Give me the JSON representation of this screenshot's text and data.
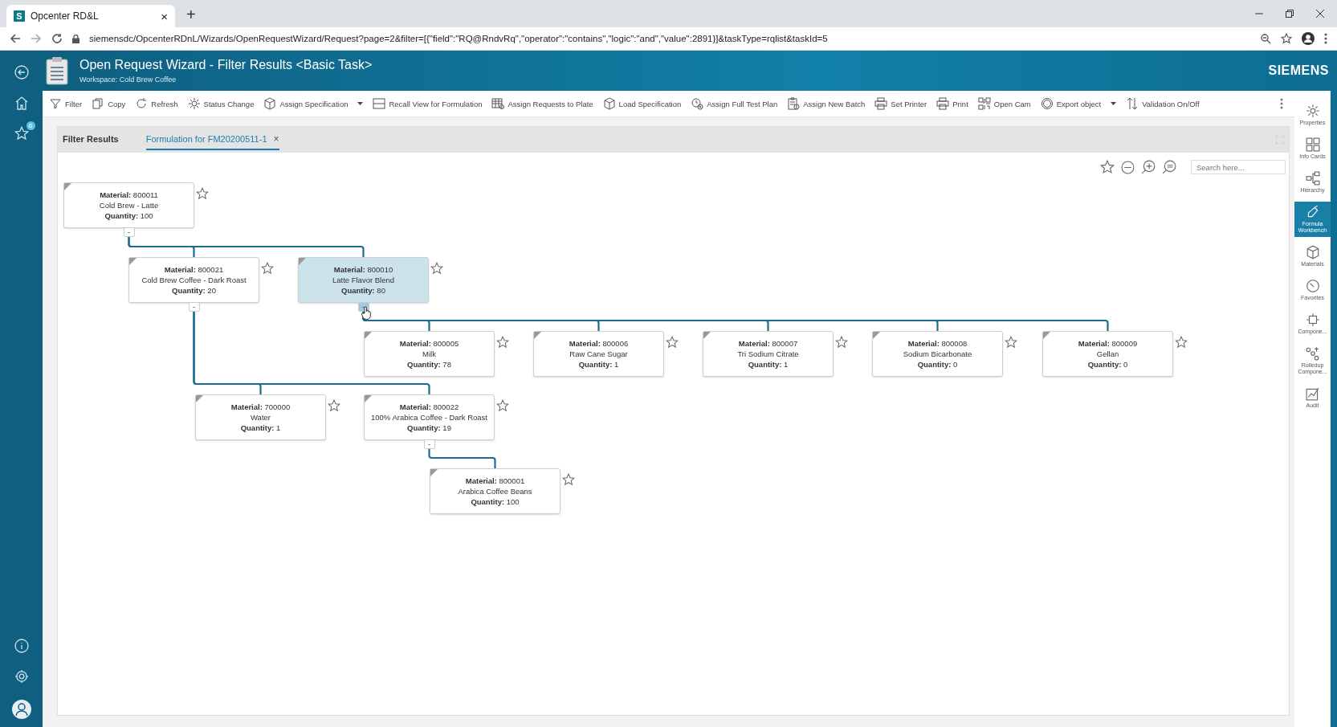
{
  "browser": {
    "tab": {
      "favicon": "S",
      "title": "Opcenter RD&L",
      "close": "×"
    },
    "new_tab": "+",
    "url": "siemensdc/OpcenterRDnL/Wizards/OpenRequestWizard/Request?page=2&filter=[{\"field\":\"RQ@RndvRq\",\"operator\":\"contains\",\"logic\":\"and\",\"value\":2891}]&taskType=rqlist&taskId=5"
  },
  "header": {
    "title": "Open Request Wizard - Filter Results <Basic Task>",
    "workspace": "Workspace: Cold Brew Coffee",
    "logo": "SIEMENS"
  },
  "left_nav": {
    "favorites_badge": "6"
  },
  "toolbar": [
    {
      "label": "Filter",
      "menu": false
    },
    {
      "label": "Copy",
      "menu": false
    },
    {
      "label": "Refresh",
      "menu": false
    },
    {
      "label": "Status Change",
      "menu": false
    },
    {
      "label": "Assign Specification",
      "menu": true
    },
    {
      "label": "Recall View for Formulation",
      "menu": false
    },
    {
      "label": "Assign Requests to Plate",
      "menu": false
    },
    {
      "label": "Load Specification",
      "menu": false
    },
    {
      "label": "Assign Full Test Plan",
      "menu": false
    },
    {
      "label": "Assign New Batch",
      "menu": false
    },
    {
      "label": "Set Printer",
      "menu": false
    },
    {
      "label": "Print",
      "menu": false
    },
    {
      "label": "Open Cam",
      "menu": false
    },
    {
      "label": "Export object",
      "menu": true
    },
    {
      "label": "Validation On/Off",
      "menu": false
    }
  ],
  "tabs": [
    {
      "label": "Filter Results",
      "selected": false
    },
    {
      "label": "Formulation for FM20200511-1",
      "selected": true,
      "close": "×"
    }
  ],
  "canvas": {
    "search": {
      "placeholder": "Search here..."
    },
    "tree": {
      "lines": [
        "**Material:** 800011",
        "Cold Brew - Latte",
        "**Quantity:** 100"
      ],
      "selected": false,
      "toggle": "-",
      "children": [
        {
          "lines": [
            "**Material:** 800021",
            "Cold Brew Coffee - Dark Roast",
            "**Quantity:** 20"
          ],
          "selected": false,
          "toggle": "-",
          "children": [
            {
              "lines": [
                "**Material:** 700000",
                "Water",
                "**Quantity:** 1"
              ],
              "selected": false
            },
            {
              "lines": [
                "**Material:** 800022",
                "100% Arabica Coffee - Dark Roast",
                "**Quantity:** 19"
              ],
              "selected": false,
              "toggle": "-",
              "children": [
                {
                  "lines": [
                    "**Material:** 800001",
                    "Arabica Coffee Beans",
                    "**Quantity:** 100"
                  ],
                  "selected": false
                }
              ]
            }
          ]
        },
        {
          "lines": [
            "**Material:** 800010",
            "Latte Flavor Blend",
            "**Quantity:** 80"
          ],
          "selected": true,
          "toggle": "-",
          "children": [
            {
              "lines": [
                "**Material:** 800005",
                "Milk",
                "**Quantity:** 78"
              ],
              "selected": false
            },
            {
              "lines": [
                "**Material:** 800006",
                "Raw Cane Sugar",
                "**Quantity:** 1"
              ],
              "selected": false
            },
            {
              "lines": [
                "**Material:** 800007",
                "Tri Sodium Citrate",
                "**Quantity:** 1"
              ],
              "selected": false
            },
            {
              "lines": [
                "**Material:** 800008",
                "Sodium Bicarbonate",
                "**Quantity:** 0"
              ],
              "selected": false
            },
            {
              "lines": [
                "**Material:** 800009",
                "Gellan",
                "**Quantity:** 0"
              ],
              "selected": false
            }
          ]
        }
      ]
    }
  },
  "right_panel": [
    {
      "label": "Properties",
      "selected": false
    },
    {
      "label": "Info Cards",
      "selected": false
    },
    {
      "label": "Hierarchy",
      "selected": false
    },
    {
      "label": "Formula Workbench",
      "selected": true
    },
    {
      "label": "Materials",
      "selected": false
    },
    {
      "label": "Favorites",
      "selected": false
    },
    {
      "label": "Compone...",
      "selected": false
    },
    {
      "label": "Rolledup Compone...",
      "selected": false
    },
    {
      "label": "Audit",
      "selected": false
    }
  ]
}
